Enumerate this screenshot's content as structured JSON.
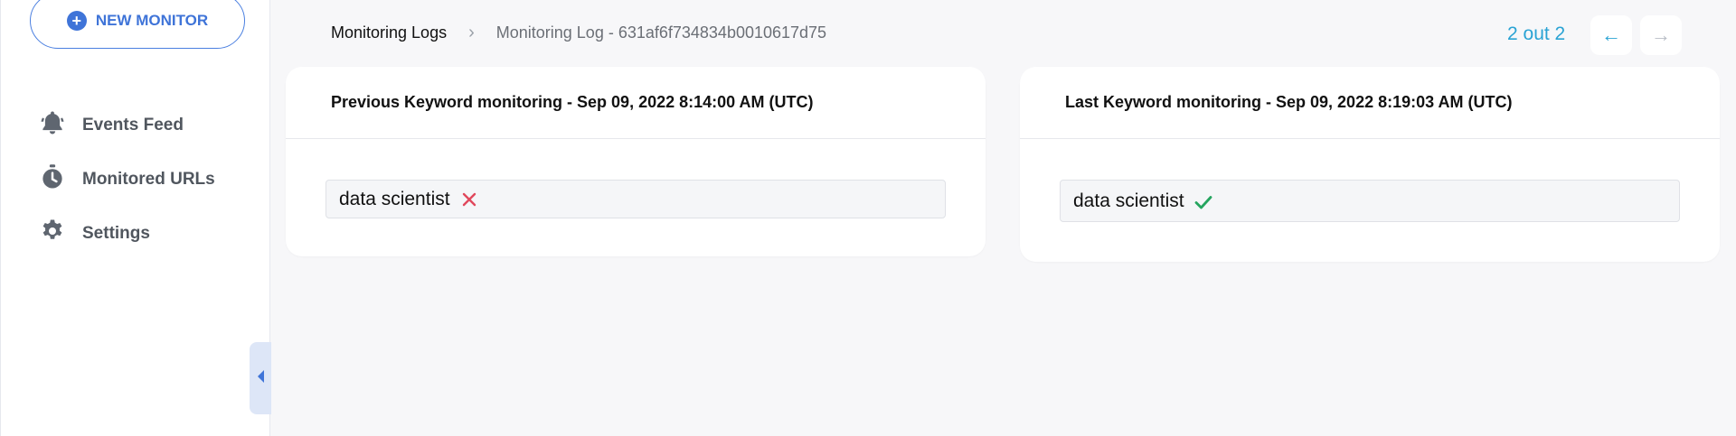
{
  "sidebar": {
    "new_monitor_label": "NEW MONITOR",
    "items": [
      {
        "label": "Events Feed",
        "icon": "bell-icon"
      },
      {
        "label": "Monitored URLs",
        "icon": "stopwatch-icon"
      },
      {
        "label": "Settings",
        "icon": "gear-icon"
      }
    ]
  },
  "breadcrumb": {
    "root": "Monitoring Logs",
    "current": "Monitoring Log - 631af6f734834b0010617d75"
  },
  "pager": {
    "text": "2 out 2",
    "prev_symbol": "←",
    "next_symbol": "→"
  },
  "cards": [
    {
      "title": "Previous Keyword monitoring - Sep 09, 2022 8:14:00 AM (UTC)",
      "keyword": "data scientist",
      "status": "not-found",
      "status_color": "#e0485c"
    },
    {
      "title": "Last Keyword monitoring - Sep 09, 2022 8:19:03 AM (UTC)",
      "keyword": "data scientist",
      "status": "found",
      "status_color": "#25a55f"
    }
  ],
  "colors": {
    "accent": "#3f74d8",
    "pager": "#2aa3d4",
    "background": "#f7f7f9"
  }
}
